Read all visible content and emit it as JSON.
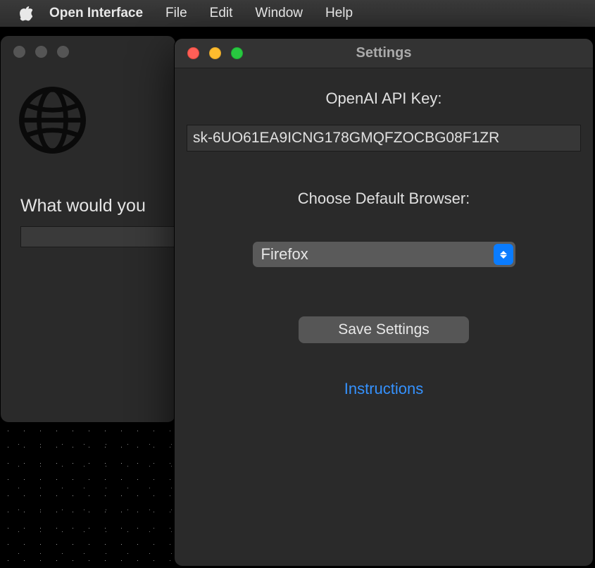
{
  "menubar": {
    "app_name": "Open Interface",
    "items": [
      "File",
      "Edit",
      "Window",
      "Help"
    ]
  },
  "background_window": {
    "heading": "What would you",
    "input_value": ""
  },
  "settings_window": {
    "title": "Settings",
    "api_key_label": "OpenAI API Key:",
    "api_key_value": "sk-6UO61EA9ICNG178GMQFZOCBG08F1ZR",
    "browser_label": "Choose Default Browser:",
    "browser_selected": "Firefox",
    "save_label": "Save Settings",
    "instructions_label": "Instructions"
  },
  "colors": {
    "accent_blue": "#0a7cff",
    "link_blue": "#3592ff",
    "traffic_close": "#ff5f57",
    "traffic_min": "#febc2e",
    "traffic_zoom": "#28c840"
  }
}
